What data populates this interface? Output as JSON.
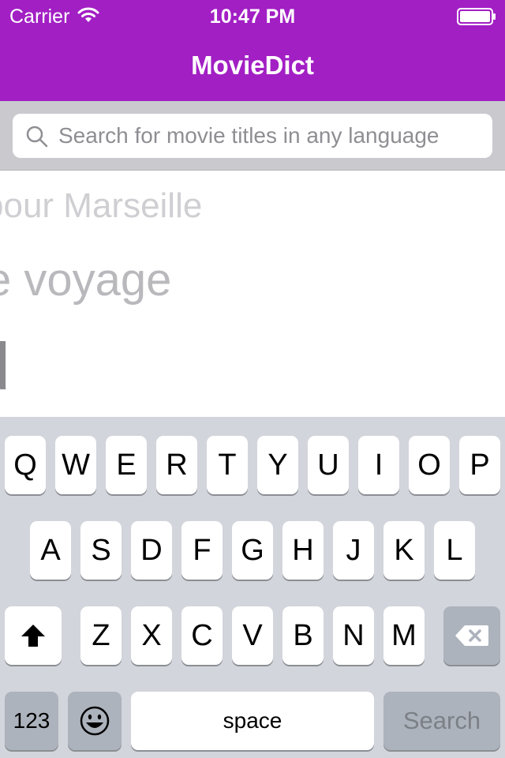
{
  "status_bar": {
    "carrier": "Carrier",
    "time": "10:47 PM"
  },
  "nav": {
    "title": "MovieDict"
  },
  "search": {
    "placeholder": "Search for movie titles in any language",
    "value": ""
  },
  "results": [
    {
      "text": "pour Marseille"
    },
    {
      "text": "e voyage"
    },
    {
      "text": "d"
    }
  ],
  "keyboard": {
    "row1": [
      "Q",
      "W",
      "E",
      "R",
      "T",
      "Y",
      "U",
      "I",
      "O",
      "P"
    ],
    "row2": [
      "A",
      "S",
      "D",
      "F",
      "G",
      "H",
      "J",
      "K",
      "L"
    ],
    "row3": [
      "Z",
      "X",
      "C",
      "V",
      "B",
      "N",
      "M"
    ],
    "numbers_label": "123",
    "space_label": "space",
    "return_label": "Search"
  },
  "colors": {
    "accent": "#a21fc4",
    "keyboard_bg": "#d2d5db",
    "function_key": "#adb3bc"
  },
  "icons": [
    "wifi-icon",
    "battery-icon",
    "search-icon",
    "shift-icon",
    "delete-icon",
    "emoji-icon"
  ]
}
